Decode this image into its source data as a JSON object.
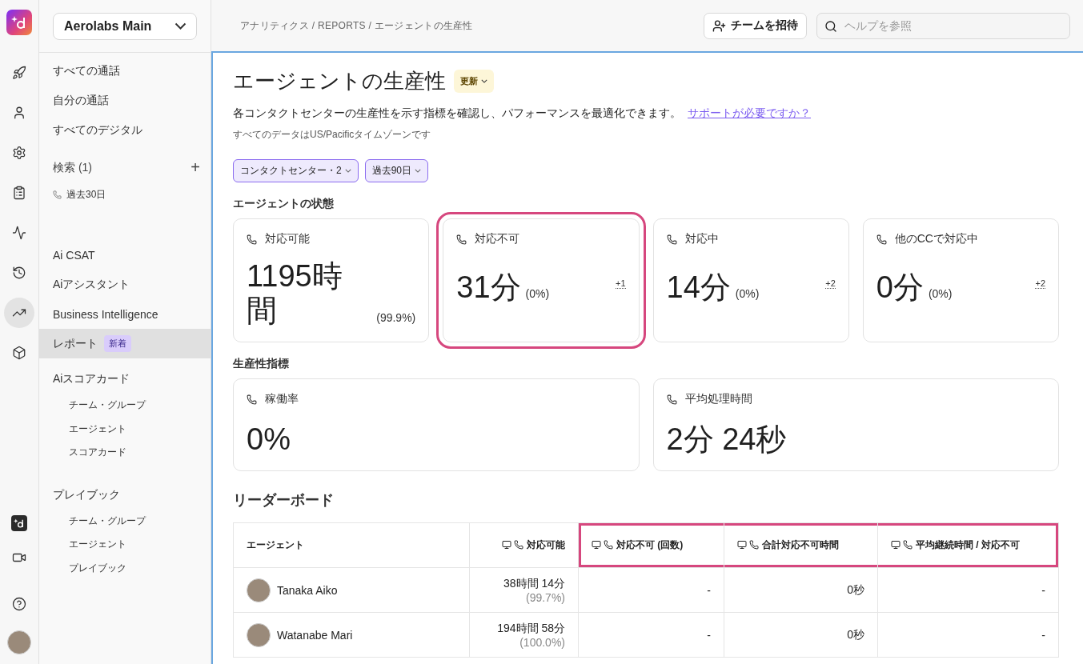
{
  "rail": {
    "items": [
      {
        "selected": false
      },
      {
        "selected": false
      },
      {
        "selected": false
      },
      {
        "selected": false
      },
      {
        "selected": false
      },
      {
        "selected": false
      },
      {
        "selected": true
      },
      {
        "selected": false
      }
    ]
  },
  "sidebar": {
    "workspace": "Aerolabs Main",
    "items": [
      {
        "kind": "link",
        "label": "すべての通話",
        "selected": false
      },
      {
        "kind": "link",
        "label": "自分の通話",
        "selected": false
      },
      {
        "kind": "link",
        "label": "すべてのデジタル",
        "selected": false
      },
      {
        "kind": "search",
        "label": "検索 (1)",
        "add": "+",
        "children": [
          {
            "label": "過去30日"
          }
        ]
      },
      {
        "kind": "link",
        "label": "Ai CSAT",
        "selected": false
      },
      {
        "kind": "link",
        "label": "Aiアシスタント",
        "selected": false
      },
      {
        "kind": "link",
        "label": "Business Intelligence",
        "selected": false
      },
      {
        "kind": "link",
        "label": "レポート",
        "badge": "新着",
        "selected": true
      },
      {
        "kind": "group",
        "label": "Aiスコアカード",
        "children": [
          {
            "label": "チーム・グループ"
          },
          {
            "label": "エージェント"
          },
          {
            "label": "スコアカード"
          }
        ]
      },
      {
        "kind": "group",
        "label": "プレイブック",
        "children": [
          {
            "label": "チーム・グループ"
          },
          {
            "label": "エージェント"
          },
          {
            "label": "プレイブック"
          }
        ]
      }
    ]
  },
  "topbar": {
    "breadcrumb": "アナリティクス / REPORTS / エージェントの生産性",
    "invite": "チームを招待",
    "search": {
      "placeholder": "ヘルプを参照"
    }
  },
  "page": {
    "title": "エージェントの生産性",
    "badge": "更新",
    "description": "各コンタクトセンターの生産性を示す指標を確認し、パフォーマンスを最適化できます。",
    "help_link": "サポートが必要ですか？",
    "note": "すべてのデータはUS/Pacificタイムゾーンです",
    "filters": [
      "コンタクトセンター・2",
      "過去90日"
    ]
  },
  "agent_status": {
    "heading": "エージェントの状態",
    "cards": [
      {
        "label": "対応可能",
        "value": "1195時間",
        "percent": "(99.9%)",
        "highlighted": false
      },
      {
        "label": "対応不可",
        "value": "31分",
        "percent": "(0%)",
        "extra": "+1",
        "highlighted": true
      },
      {
        "label": "対応中",
        "value": "14分",
        "percent": "(0%)",
        "extra": "+2",
        "highlighted": false
      },
      {
        "label": "他のCCで対応中",
        "value": "0分",
        "percent": "(0%)",
        "extra": "+2",
        "highlighted": false
      }
    ]
  },
  "productivity": {
    "heading": "生産性指標",
    "cards": [
      {
        "label": "稼働率",
        "value": "0%"
      },
      {
        "label": "平均処理時間",
        "value": "2分 24秒"
      }
    ]
  },
  "leaderboard": {
    "heading": "リーダーボード",
    "columns": [
      {
        "label": "エージェント",
        "icons": false,
        "highlighted": false
      },
      {
        "label": "対応可能",
        "icons": true,
        "highlighted": false
      },
      {
        "label": "対応不可 (回数)",
        "icons": true,
        "highlighted": true
      },
      {
        "label": "合計対応不可時間",
        "icons": true,
        "highlighted": true
      },
      {
        "label": "平均継続時間 / 対応不可",
        "icons": true,
        "highlighted": true
      }
    ],
    "rows": [
      {
        "agent": "Tanaka Aiko",
        "available": "38時間 14分",
        "available_pct": "(99.7%)",
        "unavailable_count": "-",
        "unavailable_total": "0秒",
        "avg_duration": "-"
      },
      {
        "agent": "Watanabe Mari",
        "available": "194時間 58分",
        "available_pct": "(100.0%)",
        "unavailable_count": "-",
        "unavailable_total": "0秒",
        "avg_duration": "-"
      }
    ]
  }
}
